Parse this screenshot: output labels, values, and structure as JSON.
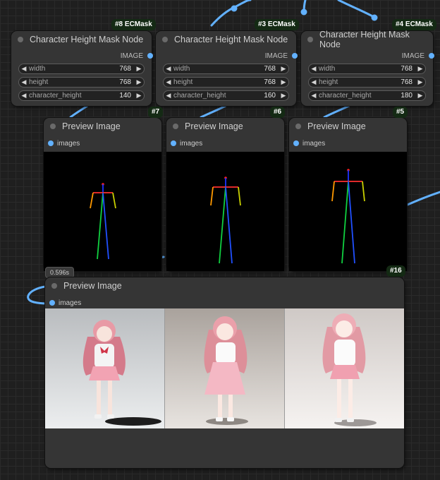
{
  "mask_nodes": [
    {
      "id_badge": "#8 ECMask",
      "title": "Character Height Mask Node",
      "output_label": "IMAGE",
      "widgets": [
        {
          "name": "width",
          "value": "768"
        },
        {
          "name": "height",
          "value": "768"
        },
        {
          "name": "character_height",
          "value": "140"
        }
      ]
    },
    {
      "id_badge": "#3 ECMask",
      "title": "Character Height Mask Node",
      "output_label": "IMAGE",
      "widgets": [
        {
          "name": "width",
          "value": "768"
        },
        {
          "name": "height",
          "value": "768"
        },
        {
          "name": "character_height",
          "value": "160"
        }
      ]
    },
    {
      "id_badge": "#4 ECMask",
      "title": "Character Height Mask Node",
      "output_label": "IMAGE",
      "widgets": [
        {
          "name": "width",
          "value": "768"
        },
        {
          "name": "height",
          "value": "768"
        },
        {
          "name": "character_height",
          "value": "180"
        }
      ]
    }
  ],
  "preview_nodes": [
    {
      "id_badge": "#7",
      "title": "Preview Image",
      "input_label": "images"
    },
    {
      "id_badge": "#6",
      "title": "Preview Image",
      "input_label": "images"
    },
    {
      "id_badge": "#5",
      "title": "Preview Image",
      "input_label": "images"
    }
  ],
  "bottom_preview": {
    "id_badge": "#16",
    "title": "Preview Image",
    "input_label": "images",
    "exec_time": "0.596s"
  },
  "colors": {
    "canvas": "#1f1f1f",
    "node": "#353535",
    "link": "#62b1ff",
    "badge_bg": "#142a14"
  }
}
